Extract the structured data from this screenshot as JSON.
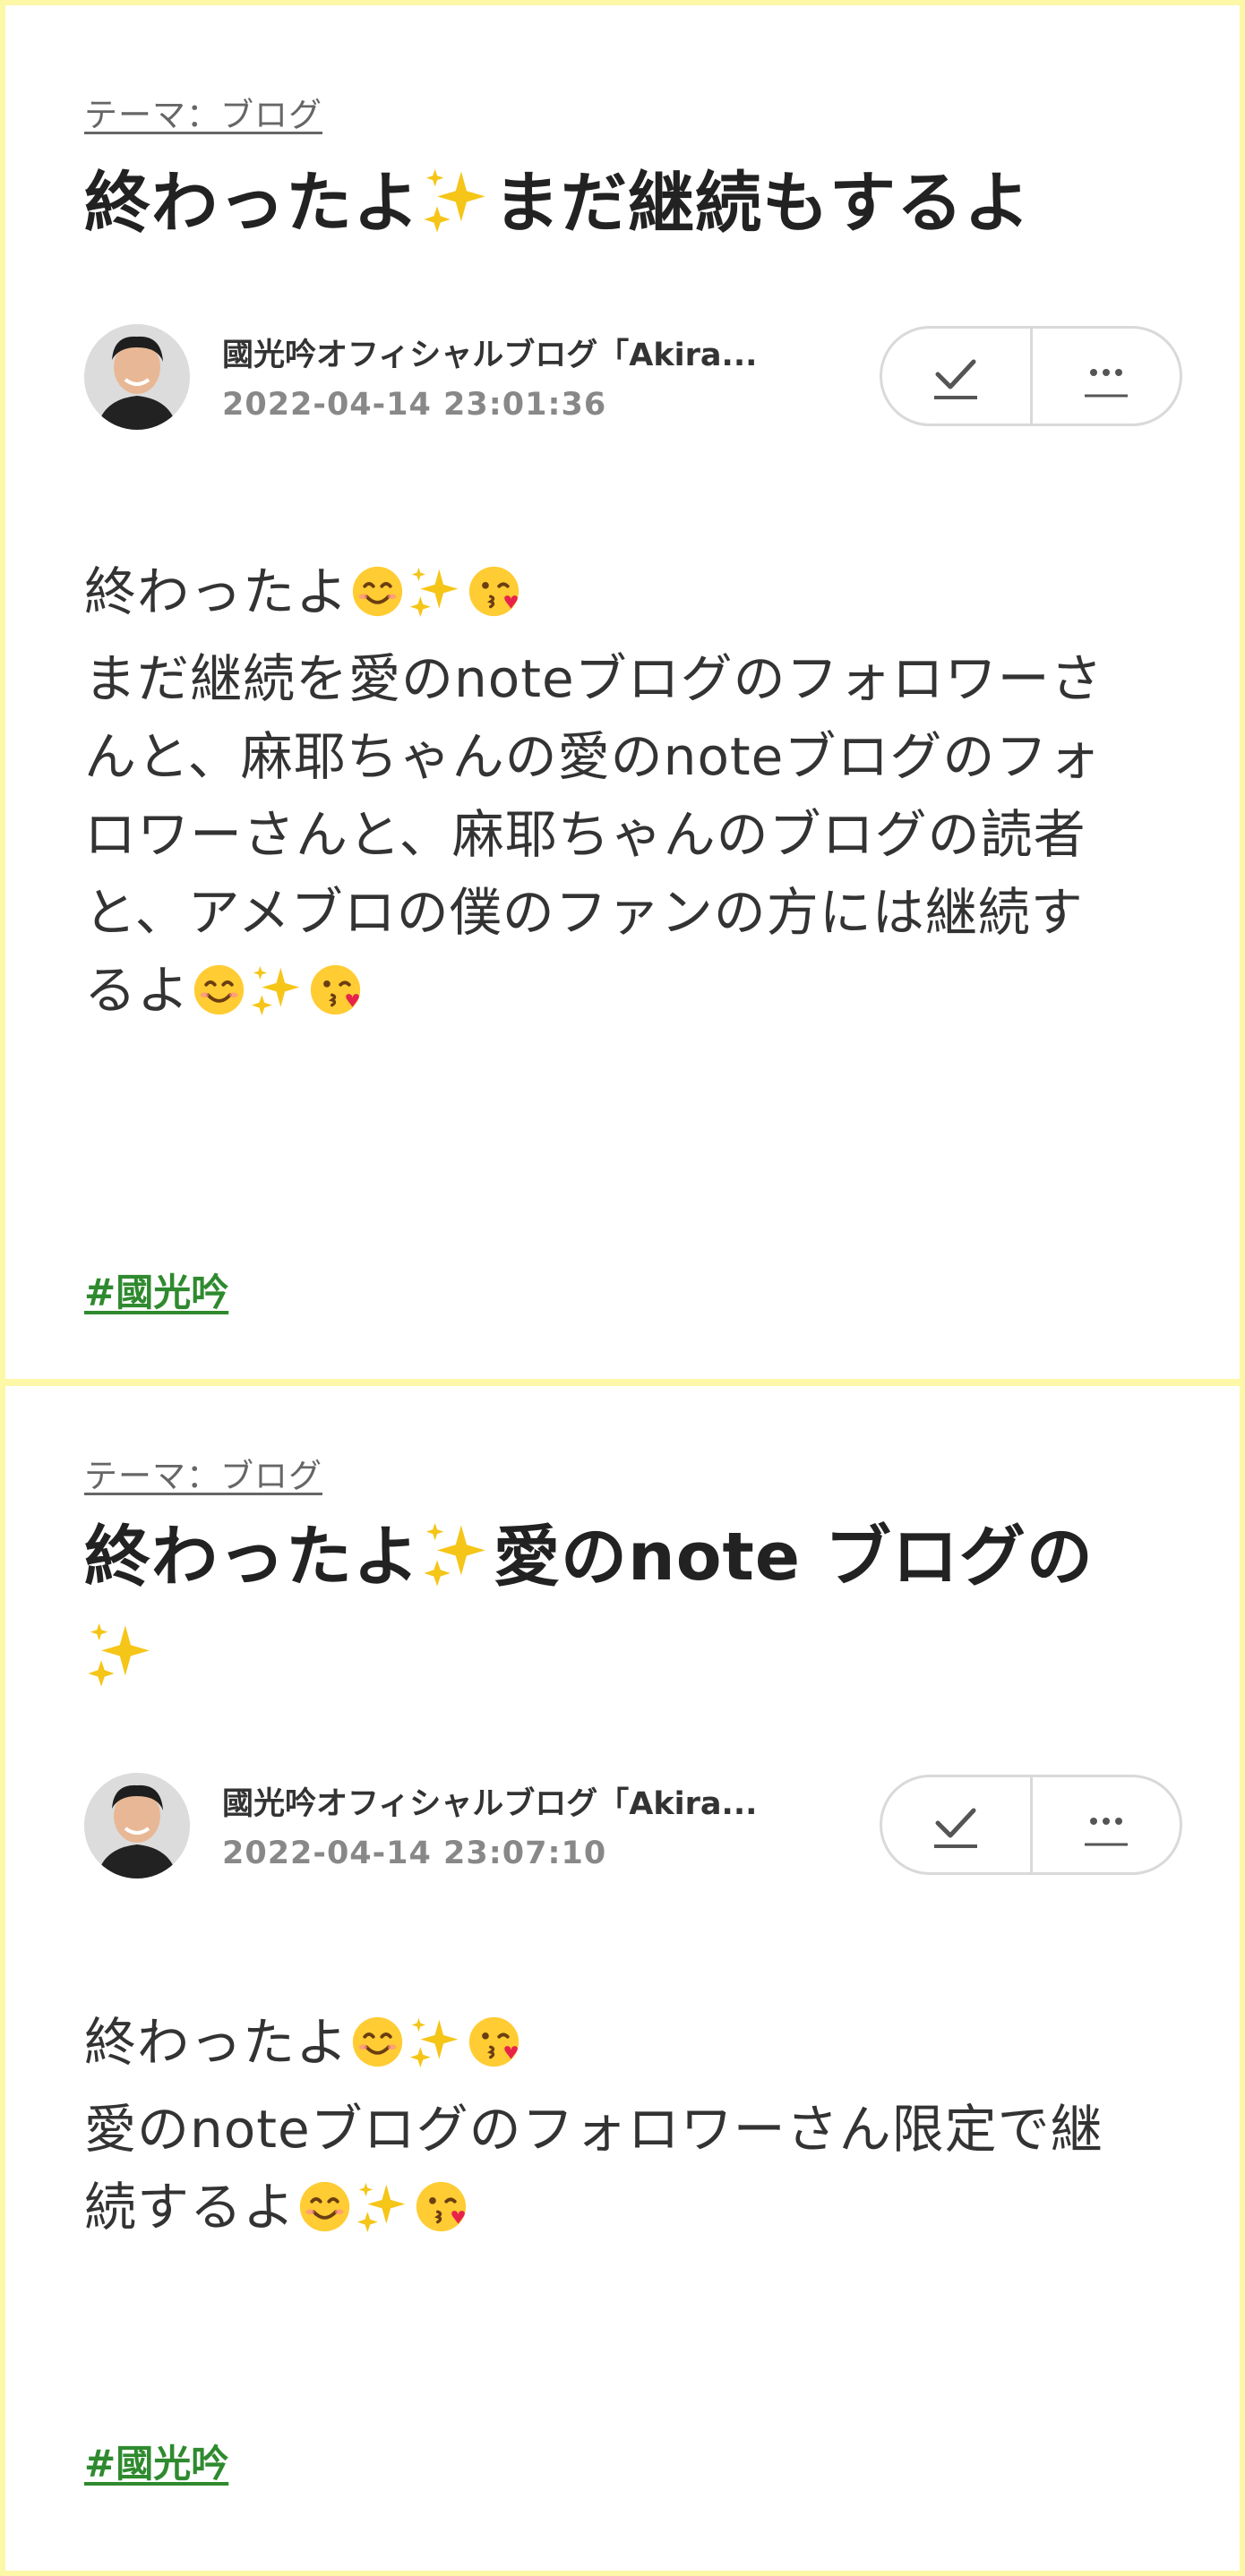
{
  "posts": [
    {
      "theme": "テーマ：ブログ",
      "title_lines": [
        "終わったよ✨まだ継続もするよ"
      ],
      "author": "國光吟オフィシャルブログ「Akira...",
      "datetime": "2022-04-14 23:01:36",
      "body_lines": [
        "終わったよ😊✨😘",
        "まだ継続を愛のnoteブログのフォロワーさ",
        "んと、麻耶ちゃんの愛のnoteブログのフォ",
        "ロワーさんと、麻耶ちゃんのブログの読者",
        "と、アメブロの僕のファンの方には継続す",
        "るよ😊✨😘"
      ],
      "hashtag": "#國光吟"
    },
    {
      "theme": "テーマ：ブログ",
      "title_lines": [
        "終わったよ✨愛のnote ブログの",
        "✨"
      ],
      "author": "國光吟オフィシャルブログ「Akira...",
      "datetime": "2022-04-14 23:07:10",
      "body_lines": [
        "終わったよ😊✨😘",
        "愛のnoteブログのフォロワーさん限定で継",
        "続するよ😊✨😘"
      ],
      "hashtag": "#國光吟"
    }
  ],
  "icons": {
    "check": "check-icon",
    "more": "more-icon"
  },
  "colors": {
    "page_border": "#fdf7a8",
    "hashtag": "#2f8a2f",
    "sparkle": "#f5c518",
    "smile_face": "#ffcc33"
  }
}
